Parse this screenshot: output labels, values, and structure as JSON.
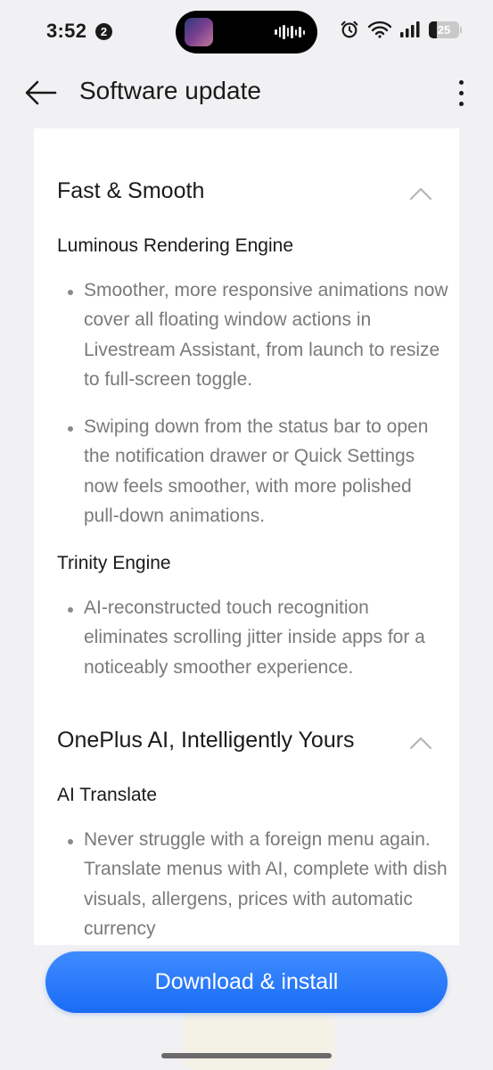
{
  "status_bar": {
    "time": "3:52",
    "notification_count": "2",
    "battery_level": "25"
  },
  "header": {
    "title": "Software update"
  },
  "sections": [
    {
      "title": "Fast & Smooth",
      "groups": [
        {
          "subtitle": "Luminous Rendering Engine",
          "bullets": [
            "Smoother, more responsive animations now cover all floating window actions in Livestream Assistant, from launch to resize to full-screen toggle.",
            "Swiping down from the status bar to open the notification drawer or Quick Settings now feels smoother, with more polished pull-down animations."
          ]
        },
        {
          "subtitle": "Trinity Engine",
          "bullets": [
            "AI-reconstructed touch recognition eliminates scrolling jitter inside apps for a noticeably smoother experience."
          ]
        }
      ]
    },
    {
      "title": "OnePlus AI, Intelligently Yours",
      "groups": [
        {
          "subtitle": "AI Translate",
          "bullets": [
            "Never struggle with a foreign menu again. Translate menus with AI, complete with dish visuals, allergens, prices with automatic currency"
          ]
        }
      ]
    }
  ],
  "actions": {
    "download_label": "Download & install"
  },
  "colors": {
    "accent": "#1a6cf5",
    "background": "#f1f1f3",
    "card": "#ffffff",
    "body_text": "#7a7a7a"
  }
}
